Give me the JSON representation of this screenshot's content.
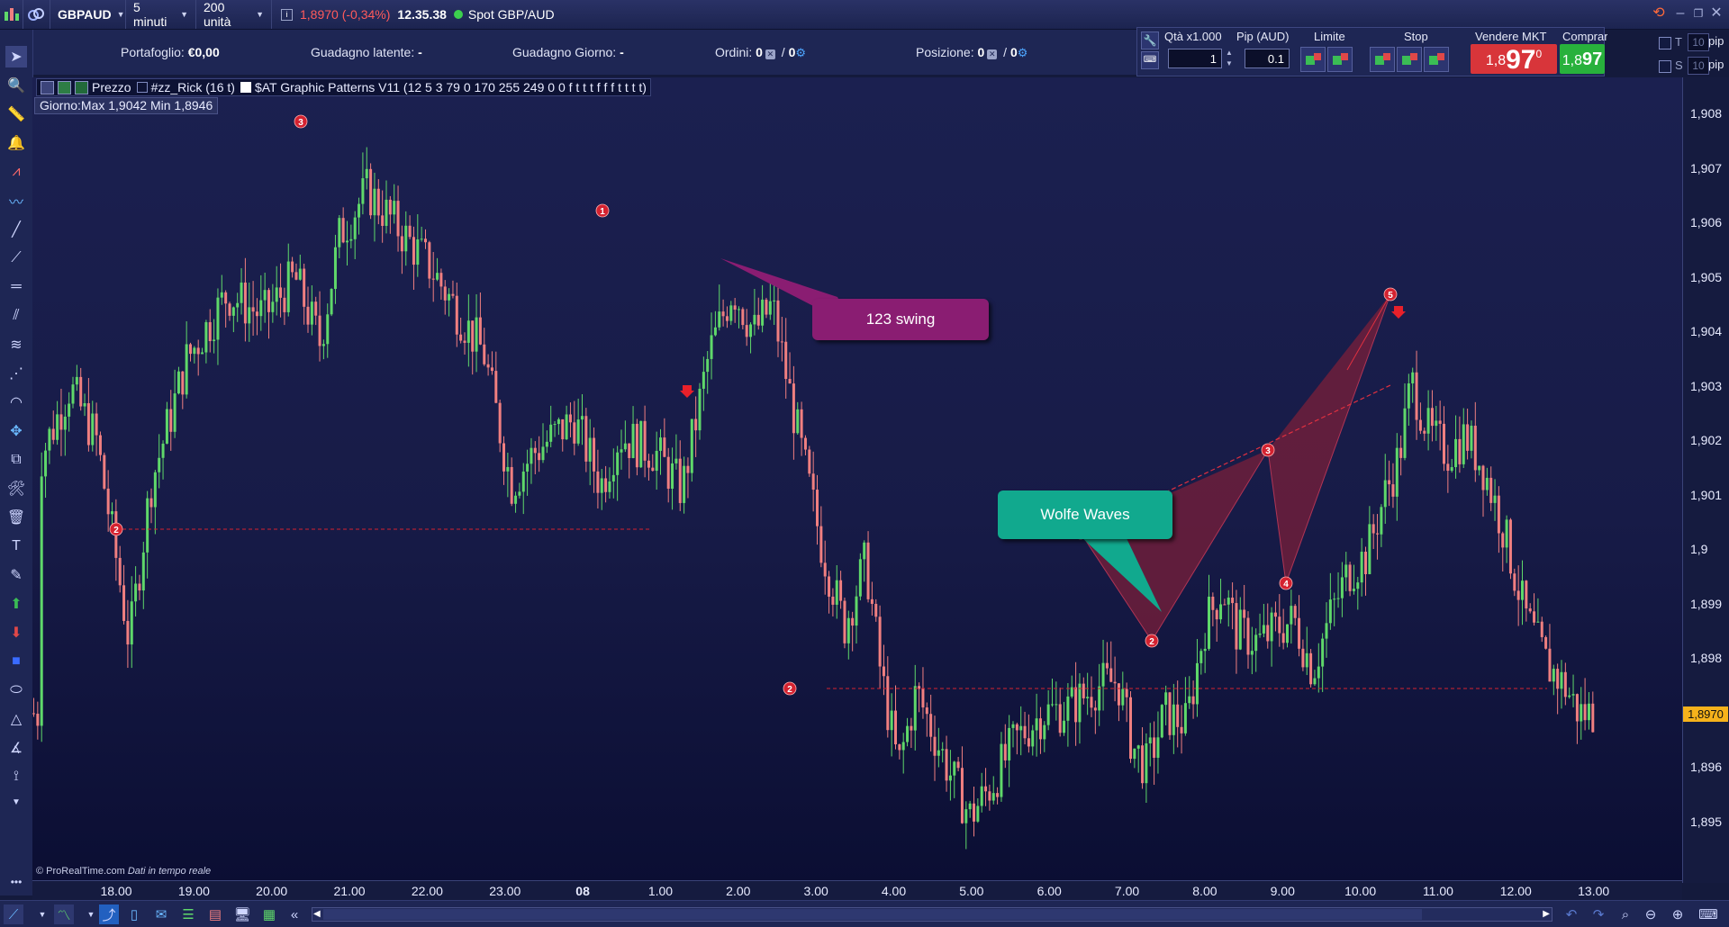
{
  "titlebar": {
    "symbol": "GBPAUD",
    "timeframe": "5 minuti",
    "units": "200 unità",
    "price_change": "1,8970 (-0,34%)",
    "time": "12.35.38",
    "instrument": "Spot GBP/AUD"
  },
  "account": {
    "portfolio_label": "Portafoglio:",
    "portfolio_value": "€0,00",
    "latent_label": "Guadagno latente:",
    "latent_value": "-",
    "day_label": "Guadagno Giorno:",
    "day_value": "-",
    "orders_label": "Ordini:",
    "orders_a": "0",
    "orders_b": "0",
    "position_label": "Posizione:",
    "position_a": "0",
    "position_b": "0"
  },
  "order_panel": {
    "qty_label": "Qtà x1.000",
    "qty_value": "1",
    "pip_label": "Pip (AUD)",
    "pip_value": "0.1",
    "limit_label": "Limite",
    "stop_label": "Stop",
    "sell_label": "Vendere MKT",
    "buy_label": "Comprare MKT",
    "sell_price_small": "1,8",
    "sell_price_big": "97",
    "sell_price_sup": "0",
    "buy_price_small": "1,8",
    "buy_price_big": "97",
    "buy_price_sup": "0",
    "t_label": "T",
    "s_label": "S",
    "t_pips": "10",
    "s_pips": "10",
    "pip_unit": "pip"
  },
  "legend": {
    "price": "Prezzo",
    "zz": "#zz_Rick (16 t)",
    "indicator": "$AT Graphic Patterns V11 (12 5 3 79 0 170 255 249 0 0 f t t t f f f t t t t)"
  },
  "range_info": "Giorno:Max 1,9042 Min 1,8946",
  "credit_brand": "© ProRealTime.com",
  "credit_note": "Dati in tempo reale",
  "callouts": {
    "swing": "123 swing",
    "wolfe": "Wolfe Waves"
  },
  "price_axis": [
    "1,908",
    "1,907",
    "1,906",
    "1,905",
    "1,904",
    "1,903",
    "1,902",
    "1,901",
    "1,9",
    "1,899",
    "1,898",
    "1,897",
    "1,896",
    "1,895"
  ],
  "last_price": "1,8970",
  "time_axis": [
    "18.00",
    "19.00",
    "20.00",
    "21.00",
    "22.00",
    "23.00",
    "08",
    "1.00",
    "2.00",
    "3.00",
    "4.00",
    "5.00",
    "6.00",
    "7.00",
    "8.00",
    "9.00",
    "10.00",
    "11.00",
    "12.00",
    "13.00"
  ],
  "colors": {
    "up": "#5fd86a",
    "down": "#f07f80",
    "marker": "#d42230",
    "swing_callout": "#8a1d72",
    "wolfe_callout": "#11a98e",
    "wolfe_fill": "#7a1f3a",
    "last_price_bg": "#f6b21b"
  },
  "chart_data": {
    "type": "candlestick",
    "ylim": [
      1.8946,
      1.9082
    ],
    "candles": [],
    "markers": [
      {
        "label": "3",
        "price": 1.9074,
        "time": "21.15"
      },
      {
        "label": "2",
        "price": 1.8981,
        "time": "18.00"
      },
      {
        "label": "1",
        "price": 1.9053,
        "time": "1.30"
      },
      {
        "label": "2",
        "price": 1.8945,
        "time": "4.45"
      },
      {
        "label": "3",
        "price": 1.8981,
        "time": "6.30"
      },
      {
        "label": "2",
        "price": 1.8957,
        "time": "7.25"
      },
      {
        "label": "3",
        "price": 1.9,
        "time": "8.50"
      },
      {
        "label": "4",
        "price": 1.8971,
        "time": "9.05"
      },
      {
        "label": "5",
        "price": 1.9035,
        "time": "10.25"
      }
    ]
  }
}
